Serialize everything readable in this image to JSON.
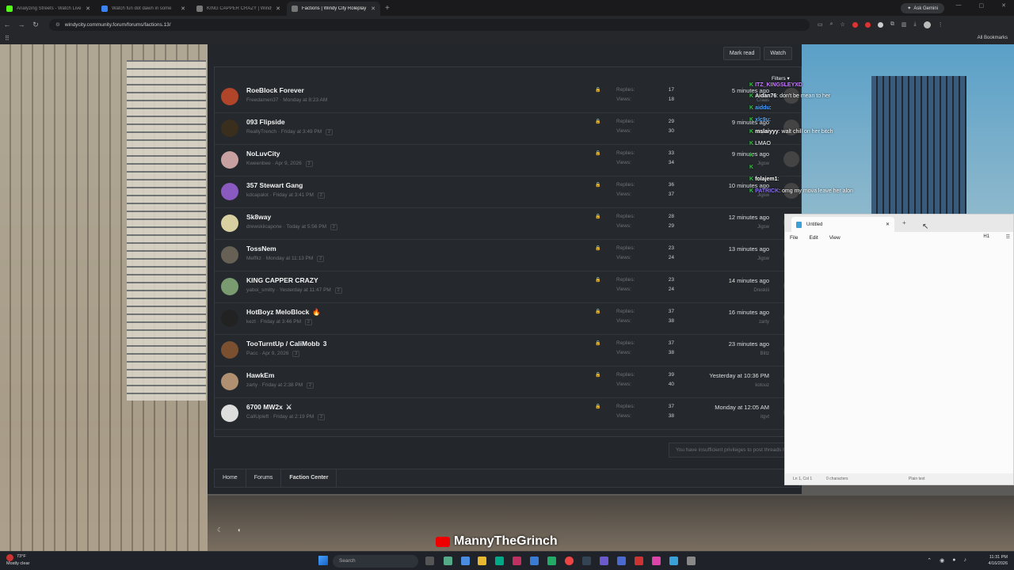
{
  "browser": {
    "tabs": [
      {
        "label": "Analyzing Streets - Watch Live",
        "color": "#53fc18"
      },
      {
        "label": "Watch fun dot dawn in some",
        "color": "#3b82f6"
      },
      {
        "label": "KING CAPPER CRAZY | Windy",
        "color": "#777777"
      },
      {
        "label": "Factions | Windy City Roleplay",
        "color": "#777777",
        "active": true
      }
    ],
    "new_tab": "+",
    "ask_gemini": "Ask Gemini",
    "url": "windycity.community.forum/forums/factions.13/",
    "all_bookmarks": "All Bookmarks"
  },
  "forum": {
    "mark_read": "Mark read",
    "watch": "Watch",
    "replies_label": "Replies:",
    "views_label": "Views:",
    "threads": [
      {
        "title": "RoeBlock Forever",
        "meta": "Freedamen37 · Monday at 8:23 AM",
        "pages": "",
        "replies": "17",
        "views": "18",
        "last": "5 minutes ago",
        "last_by": "Craas",
        "avatar": "#b0452a"
      },
      {
        "title": "093 Flipside",
        "meta": "ReallyTrench · Friday at 3:49 PM",
        "pages": "2",
        "replies": "29",
        "views": "30",
        "last": "9 minutes ago",
        "last_by": "Jigsw",
        "avatar": "#3a2e1c"
      },
      {
        "title": "NoLuvCity",
        "meta": "Kweenbee · Apr 9, 2026",
        "pages": "2",
        "replies": "33",
        "views": "34",
        "last": "9 minutes ago",
        "last_by": "Jigsw",
        "avatar": "#c9a0a0"
      },
      {
        "title": "357 Stewart Gang",
        "meta": "kdcapalot · Friday at 3:41 PM",
        "pages": "2",
        "replies": "36",
        "views": "37",
        "last": "10 minutes ago",
        "last_by": "Jigsw",
        "avatar": "#8a5ac0"
      },
      {
        "title": "Sk8way",
        "meta": "drewskiicapone · Today at 5:56 PM",
        "pages": "2",
        "replies": "28",
        "views": "29",
        "last": "12 minutes ago",
        "last_by": "Jigsw",
        "avatar": "#d8d0a0"
      },
      {
        "title": "TossNem",
        "meta": "Meffkz · Monday at 11:13 PM",
        "pages": "2",
        "replies": "23",
        "views": "24",
        "last": "13 minutes ago",
        "last_by": "Jigsw",
        "avatar": "#666055"
      },
      {
        "title": "KING CAPPER CRAZY",
        "meta": "yaboi_smitty · Yesterday at 11:47 PM",
        "pages": "2",
        "replies": "23",
        "views": "24",
        "last": "14 minutes ago",
        "last_by": "Dreskiii",
        "avatar": "#7a9a70"
      },
      {
        "title": "HotBoyz MeloBlock",
        "emoji": "🔥",
        "meta": "kezt · Friday at 3:46 PM",
        "pages": "2",
        "replies": "37",
        "views": "38",
        "last": "16 minutes ago",
        "last_by": "zarty",
        "avatar": "#222222"
      },
      {
        "title": "TooTurntUp / CaliMobb",
        "emoji": "3",
        "meta": "Pacc · Apr 9, 2026",
        "pages": "2",
        "replies": "37",
        "views": "38",
        "last": "23 minutes ago",
        "last_by": "Blitz",
        "avatar": "#7a5030"
      },
      {
        "title": "HawkEm",
        "meta": "zarty · Friday at 2:38 PM",
        "pages": "2",
        "replies": "39",
        "views": "40",
        "last": "Yesterday at 10:36 PM",
        "last_by": "kotouz",
        "avatar": "#b09070"
      },
      {
        "title": "6700 MW2x",
        "emoji": "⚔",
        "meta": "CallUpleft · Friday at 2:19 PM",
        "pages": "2",
        "replies": "37",
        "views": "38",
        "last": "Monday at 12:05 AM",
        "last_by": "itgvt",
        "avatar": "#dddddd"
      }
    ],
    "no_privileges": "You have insufficient privileges to post threads here.",
    "breadcrumbs": [
      "Home",
      "Forums",
      "Faction Center"
    ]
  },
  "chat": {
    "filters": "Filters ▾",
    "lines": [
      {
        "user": "ITZ_KINGSLEYXD",
        "msg": "",
        "color": "#c77dff"
      },
      {
        "user": "Aidan76",
        "msg": ": don't be mean to her",
        "color": "#ffffff"
      },
      {
        "user": "aiddu",
        "msg": ":",
        "color": "#4aa3ff"
      },
      {
        "user": "xlc9u",
        "msg": ":",
        "color": "#4aa3ff"
      },
      {
        "user": "mslaiyyy",
        "msg": ": walt chill on her bitch",
        "color": "#ffffff"
      },
      {
        "user": "",
        "msg": "LMAO",
        "color": "#ffffff"
      },
      {
        "user": "",
        "msg": "",
        "color": "#ff4444"
      },
      {
        "user": "",
        "msg": "",
        "color": "#ff4444"
      },
      {
        "user": "folajem1",
        "msg": ":",
        "color": "#ffffff"
      },
      {
        "user": "PATRICK",
        "msg": ": omg my mova leave her alon",
        "color": "#8a6cff"
      }
    ]
  },
  "notepad": {
    "tab_title": "Untitled",
    "menu": [
      "File",
      "Edit",
      "View"
    ],
    "heading": "H1",
    "status_pos": "Ln 1, Col 1",
    "status_chars": "0 characters",
    "status_type": "Plain text"
  },
  "watermark": "MannyTheGrinch",
  "taskbar": {
    "temp": "73°F",
    "weather": "Mostly clear",
    "search": "Search",
    "time": "11:31 PM",
    "date": "4/16/2026"
  }
}
